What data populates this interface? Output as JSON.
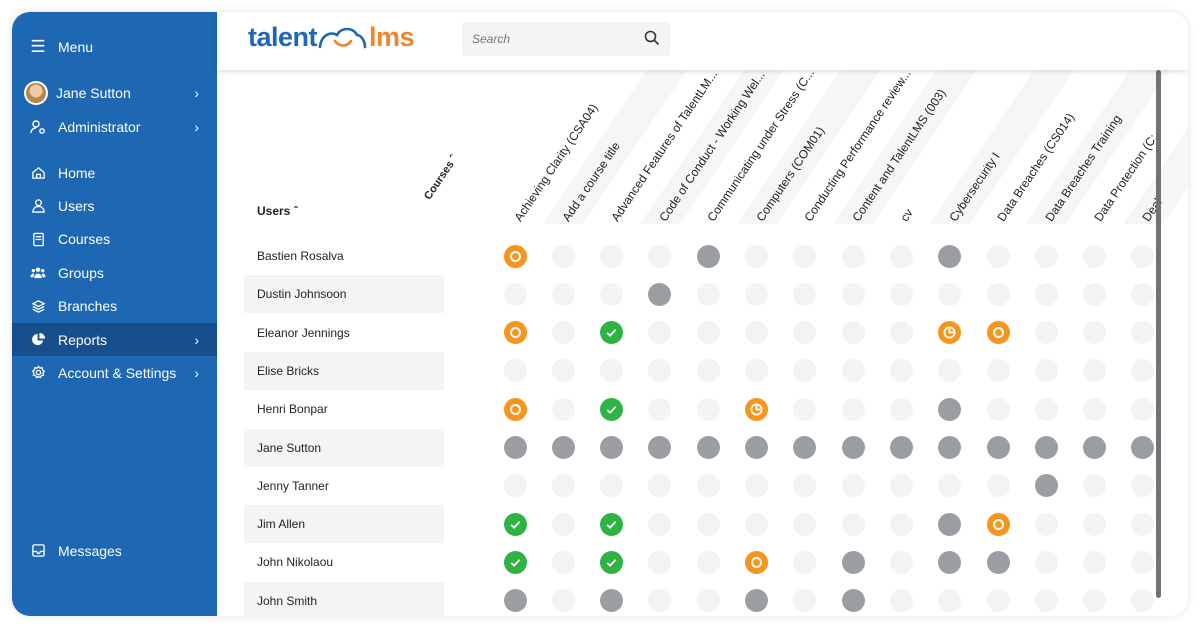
{
  "sidebar": {
    "menu": "Menu",
    "user": "Jane Sutton",
    "role": "Administrator",
    "items": [
      {
        "label": "Home",
        "icon": "home-icon"
      },
      {
        "label": "Users",
        "icon": "user-icon"
      },
      {
        "label": "Courses",
        "icon": "book-icon"
      },
      {
        "label": "Groups",
        "icon": "groups-icon"
      },
      {
        "label": "Branches",
        "icon": "layers-icon"
      },
      {
        "label": "Reports",
        "icon": "pie-chart-icon",
        "active": true
      },
      {
        "label": "Account & Settings",
        "icon": "gear-icon"
      }
    ],
    "messages": "Messages"
  },
  "header": {
    "logo": "talentlms",
    "logo_left": "talent",
    "logo_right": "lms",
    "search_placeholder": "Search"
  },
  "colors": {
    "brand": "#1d67b3",
    "accent": "#f0852d",
    "completed": "#2fb344",
    "in_progress": "#f7941d",
    "not_started": "#9a9ea2",
    "not_enrolled": "#f3f3f3"
  },
  "matrix": {
    "users_header": "Users",
    "courses_header": "Courses",
    "courses": [
      "Achieving Clarity (CSA04)",
      "Add a course title",
      "Advanced Features of TalentLM...",
      "Code of Conduct - Working Wel...",
      "Communicating under Stress (C...",
      "Computers (COM01)",
      "Conducting Performance review...",
      "Content and TalentLMS (003)",
      "cv",
      "Cybersecurity I",
      "Data Breaches (CS014)",
      "Data Breaches Training",
      "Data Protection (C:",
      "Deal"
    ],
    "users": [
      "Bastien Rosalva",
      "Dustin Johnsoon",
      "Eleanor Jennings",
      "Elise Bricks",
      "Henri Bonpar",
      "Jane Sutton",
      "Jenny Tanner",
      "Jim Allen",
      "John Nikolaou",
      "John Smith"
    ],
    "legend": {
      "e": "not-enrolled",
      "n": "not-started",
      "i": "in-progress",
      "p": "partially-completed",
      "c": "completed"
    },
    "status": [
      "ieeeneeeeneeee",
      "eeeneeeeeeeeee",
      "ieceeeeeepieee",
      "eeeeeeeeeeeeee",
      "ieceepeeeneeee",
      "nnnnnnnnnnnnnn",
      "eeeeeeeeeeenee",
      "ceceeeeeenieee",
      "ceceeienenneee",
      "neneeneneeeeee"
    ]
  }
}
